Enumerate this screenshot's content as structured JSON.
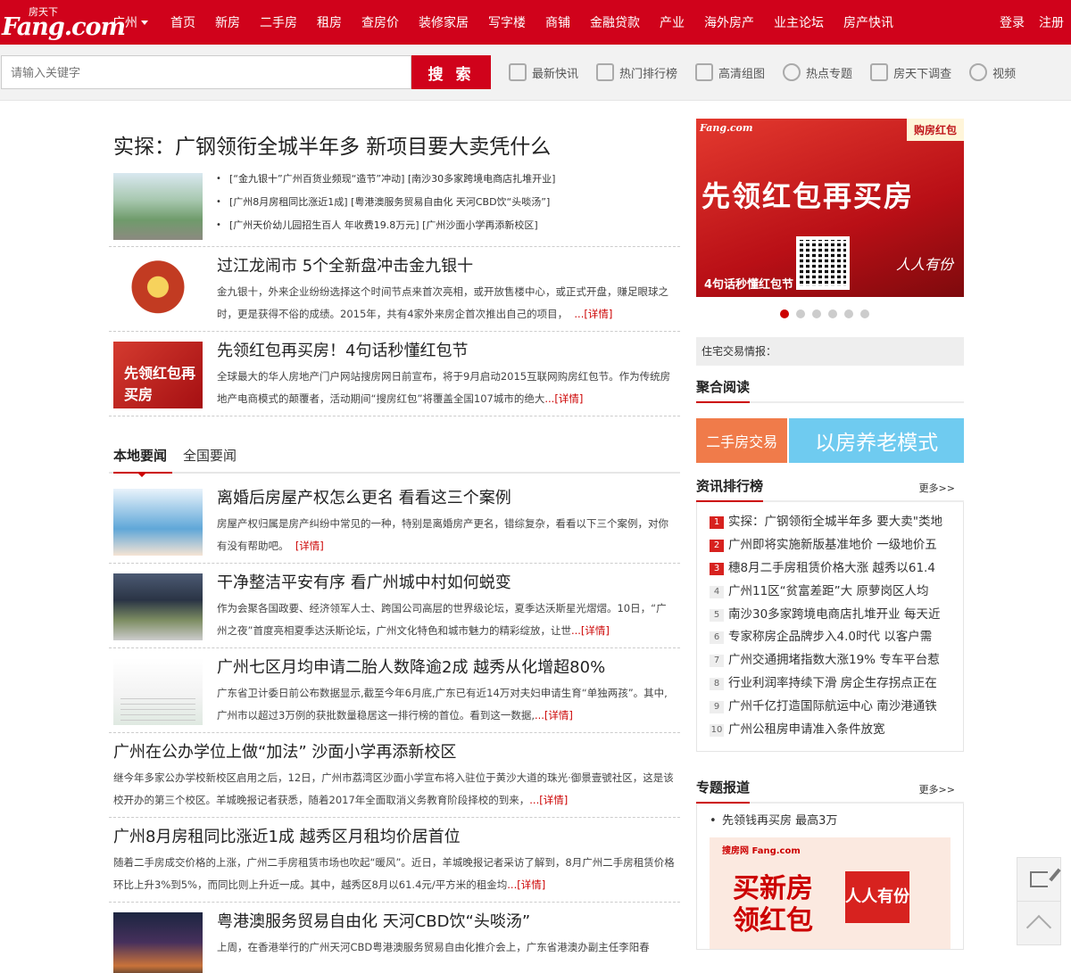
{
  "header": {
    "logo_small": "房天下",
    "logo_big": "Fang.com",
    "city": "广州",
    "nav": [
      "首页",
      "新房",
      "二手房",
      "租房",
      "查房价",
      "装修家居",
      "写字楼",
      "商铺",
      "金融贷款",
      "产业",
      "海外房产",
      "业主论坛",
      "房产快讯"
    ],
    "login": "登录",
    "register": "注册"
  },
  "search": {
    "placeholder": "请输入关键字",
    "button": "搜 索",
    "quick_links": [
      {
        "label": "最新快讯",
        "icon": "list-icon"
      },
      {
        "label": "热门排行榜",
        "icon": "ranking-icon"
      },
      {
        "label": "高清组图",
        "icon": "chart-icon"
      },
      {
        "label": "热点专题",
        "icon": "flame-icon"
      },
      {
        "label": "房天下调查",
        "icon": "edit-icon"
      },
      {
        "label": "视频",
        "icon": "play-icon"
      }
    ]
  },
  "top_story": {
    "headline": "实探：广钢领衔全城半年多 新项目要大卖凭什么",
    "bullets": [
      "[“金九银十”广州百货业频现“造节”冲动] [南沙30多家跨境电商店扎堆开业]",
      "[广州8月房租同比涨近1成] [粤港澳服务贸易自由化 天河CBD饮“头啖汤”]",
      "[广州天价幼儿园招生百人 年收费19.8万元] [广州沙面小学再添新校区]"
    ]
  },
  "features": [
    {
      "title": "过江龙闹市 5个全新盘冲击金九银十",
      "summary": "金九银十，外来企业纷纷选择这个时间节点来首次亮相，或开放售楼中心，或正式开盘，赚足眼球之时，更是获得不俗的成绩。2015年，共有4家外来房企首次推出自己的项目，",
      "more": "...[详情]"
    },
    {
      "title": "先领红包再买房！4句话秒懂红包节",
      "summary": "全球最大的华人房地产门户网站搜房网日前宣布，将于9月启动2015互联网购房红包节。作为传统房地产电商模式的颠覆者，活动期间“搜房红包”将覆盖全国107城市的绝大",
      "more": "...[详情]",
      "thumb_text": "先领红包再买房"
    }
  ],
  "tabs": {
    "local": "本地要闻",
    "national": "全国要闻"
  },
  "local_news": [
    {
      "title": "离婚后房屋产权怎么更名 看看这三个案例",
      "summary": "房屋产权归属是房产纠纷中常见的一种，特别是离婚房产更名，错综复杂，看看以下三个案例，对你有没有帮助吧。",
      "more": "[详情]"
    },
    {
      "title": "干净整洁平安有序 看广州城中村如何蜕变",
      "summary": "作为会聚各国政要、经济领军人士、跨国公司高层的世界级论坛，夏季达沃斯星光熠熠。10日，“广州之夜”首度亮相夏季达沃斯论坛，广州文化特色和城市魅力的精彩绽放，让世",
      "more": "...[详情]"
    },
    {
      "title": "广州七区月均申请二胎人数降逾2成 越秀从化增超80%",
      "summary": "广东省卫计委日前公布数据显示,截至今年6月底,广东已有近14万对夫妇申请生育“单独两孩”。其中,广州市以超过3万例的获批数量稳居这一排行榜的首位。看到这一数据,",
      "more": "...[详情]"
    },
    {
      "title": "广州在公办学位上做“加法” 沙面小学再添新校区",
      "summary": "继今年多家公办学校新校区启用之后，12日，广州市荔湾区沙面小学宣布将入驻位于黄沙大道的珠光·御景壹號社区，这是该校开办的第三个校区。羊城晚报记者获悉，随着2017年全面取消义务教育阶段择校的到来，",
      "more": "...[详情]"
    },
    {
      "title": "广州8月房租同比涨近1成 越秀区月租均价居首位",
      "summary": "随着二手房成交价格的上涨，广州二手房租赁市场也吹起“暖风”。近日，羊城晚报记者采访了解到，8月广州二手房租赁价格环比上升3%到5%，而同比则上升近一成。其中，越秀区8月以61.4元/平方米的租金均",
      "more": "...[详情]"
    },
    {
      "title": "粤港澳服务贸易自由化 天河CBD饮“头啖汤”",
      "summary": "上周，在香港举行的广州天河CBD粤港澳服务贸易自由化推介会上，广东省港澳办副主任李阳春",
      "more": ""
    }
  ],
  "sidebar": {
    "banner": {
      "logo": "Fang.com",
      "tag": "购房红包",
      "main_text": "先领红包再买房",
      "caption": "4句话秒懂红包节",
      "side_text": "人人有份",
      "slide_count": 6,
      "active_slide": 1
    },
    "trade_info": "住宅交易情报：",
    "aggregate_title": "聚合阅读",
    "ad_left": "二手房交易",
    "ad_right": "以房养老模式",
    "ranking_title": "资讯排行榜",
    "more": "更多>>",
    "ranking": [
      "实探：广钢领衔全城半年多 要大卖\"类地",
      "广州即将实施新版基准地价 一级地价五",
      "穗8月二手房租赁价格大涨 越秀以61.4",
      "广州11区“贫富差距”大 原萝岗区人均",
      "南沙30多家跨境电商店扎堆开业 每天近",
      "专家称房企品牌步入4.0时代 以客户需",
      "广州交通拥堵指数大涨19% 专车平台惹",
      "行业利润率持续下滑 房企生存拐点正在",
      "广州千亿打造国际航运中心 南沙港通铁",
      "广州公租房申请准入条件放宽"
    ],
    "topic_title": "专题报道",
    "topic_more": "更多>>",
    "topic_item": "先领钱再买房 最高3万",
    "topic_ad": {
      "logo": "搜房网 Fang.com",
      "big": "买新房领红包",
      "badge": "人人有份"
    }
  }
}
